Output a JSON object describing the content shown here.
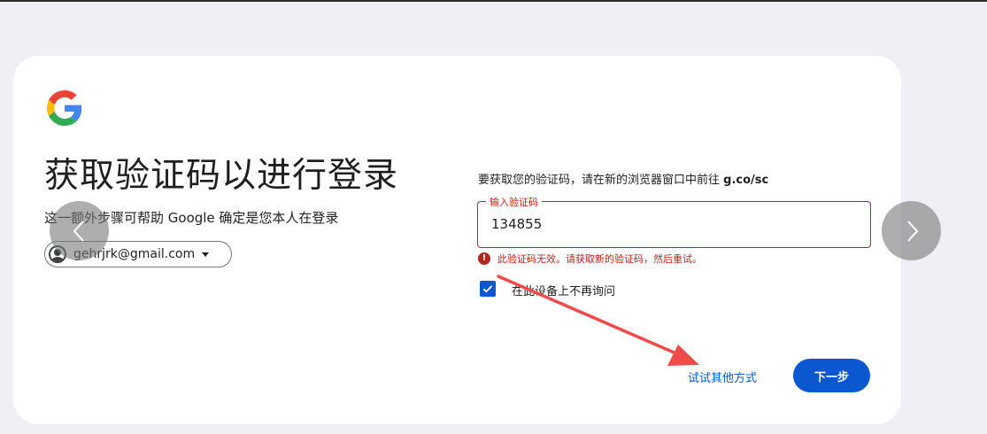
{
  "header": {
    "logo": "google-g-logo"
  },
  "main": {
    "title": "获取验证码以进行登录",
    "subtitle": "这一额外步骤可帮助 Google 确定是您本人在登录",
    "account_email": "gehrjrk@gmail.com"
  },
  "form": {
    "instruction_text": "要获取您的验证码，请在新的浏览器窗口中前往 ",
    "instruction_link": "g.co/sc",
    "code_label": "输入验证码",
    "code_value": "134855",
    "error_text": "此验证码无效。请获取新的验证码，然后重试。",
    "error_icon_glyph": "!",
    "remember_label": "在此设备上不再询问",
    "remember_checked": true,
    "try_other_label": "试试其他方式",
    "next_label": "下一步"
  },
  "colors": {
    "accent": "#0b57d0",
    "error": "#b3261e",
    "annotation_arrow": "#ef4b4b"
  },
  "icons": {
    "nav_left": "chevron-left-icon",
    "nav_right": "chevron-right-icon",
    "checkbox": "check-icon",
    "error": "error-icon",
    "caret": "caret-down-icon"
  }
}
